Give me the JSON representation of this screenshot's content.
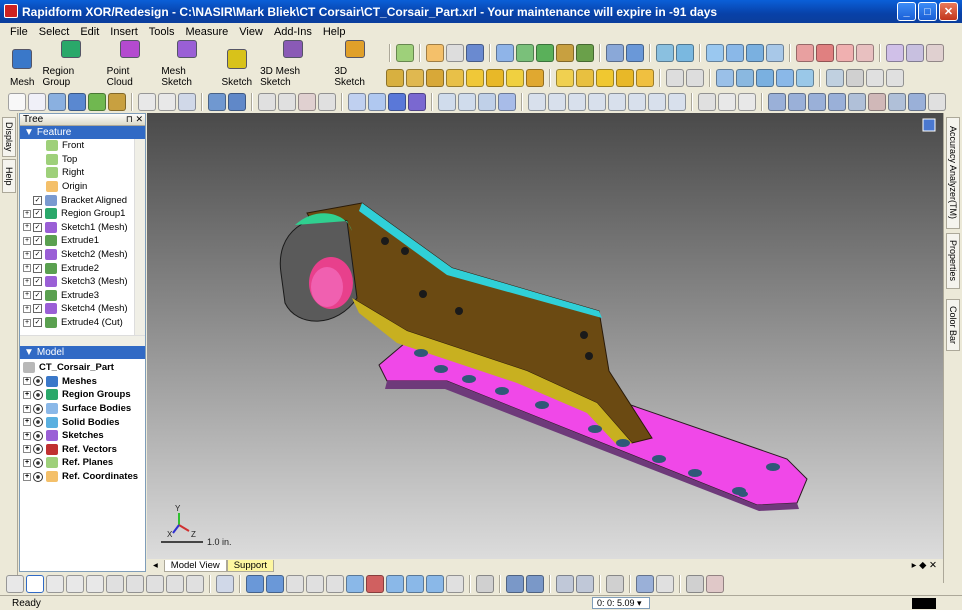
{
  "window": {
    "title": "Rapidform XOR/Redesign - C:\\NASIR\\Mark Bliek\\CT Corsair\\CT_Corsair_Part.xrl - Your maintenance will expire in -91 days",
    "minimize": "_",
    "maximize": "□",
    "close": "✕"
  },
  "menu": [
    "File",
    "Select",
    "Edit",
    "Insert",
    "Tools",
    "Measure",
    "View",
    "Add-Ins",
    "Help"
  ],
  "big_toolbar": [
    {
      "label": "Mesh",
      "color": "#3a78c9"
    },
    {
      "label": "Region Group",
      "color": "#2aa86a"
    },
    {
      "label": "Point Cloud",
      "color": "#b44ad0"
    },
    {
      "label": "Mesh Sketch",
      "color": "#9a5fd6"
    },
    {
      "label": "Sketch",
      "color": "#d8c21a"
    },
    {
      "label": "3D Mesh Sketch",
      "color": "#8a5ab6"
    },
    {
      "label": "3D Sketch",
      "color": "#e0a02a"
    }
  ],
  "left_strip_tabs": [
    "Display",
    "Help"
  ],
  "right_strip_tabs": [
    "Accuracy Analyzer(TM)",
    "Properties",
    "Color Bar"
  ],
  "tree_panel": {
    "title": "Tree",
    "feature_section": "Feature",
    "features": [
      {
        "label": "Front",
        "icon": "plane-icon",
        "expand": false,
        "check": false
      },
      {
        "label": "Top",
        "icon": "plane-icon",
        "expand": false,
        "check": false
      },
      {
        "label": "Right",
        "icon": "plane-icon",
        "expand": false,
        "check": false
      },
      {
        "label": "Origin",
        "icon": "origin-icon",
        "expand": false,
        "check": false
      },
      {
        "label": "Bracket Aligned",
        "icon": "align-icon",
        "expand": false,
        "check": true
      },
      {
        "label": "Region Group1",
        "icon": "region-group-icon",
        "expand": true,
        "check": true
      },
      {
        "label": "Sketch1 (Mesh)",
        "icon": "mesh-sketch-icon",
        "expand": true,
        "check": true
      },
      {
        "label": "Extrude1",
        "icon": "extrude-icon",
        "expand": true,
        "check": true
      },
      {
        "label": "Sketch2 (Mesh)",
        "icon": "mesh-sketch-icon",
        "expand": true,
        "check": true
      },
      {
        "label": "Extrude2",
        "icon": "extrude-icon",
        "expand": true,
        "check": true
      },
      {
        "label": "Sketch3 (Mesh)",
        "icon": "mesh-sketch-icon",
        "expand": true,
        "check": true
      },
      {
        "label": "Extrude3",
        "icon": "extrude-icon",
        "expand": true,
        "check": true
      },
      {
        "label": "Sketch4 (Mesh)",
        "icon": "mesh-sketch-icon",
        "expand": true,
        "check": true
      },
      {
        "label": "Extrude4 (Cut)",
        "icon": "extrude-icon",
        "expand": true,
        "check": true
      }
    ],
    "model_section": "Model",
    "model_root": "CT_Corsair_Part",
    "model_items": [
      "Meshes",
      "Region Groups",
      "Surface Bodies",
      "Solid Bodies",
      "Sketches",
      "Ref. Vectors",
      "Ref. Planes",
      "Ref. Coordinates"
    ]
  },
  "viewport": {
    "scale_label": "1.0 in.",
    "axis_labels": {
      "y": "Y",
      "x": "X",
      "z": "Z"
    }
  },
  "bottom_tabs": [
    "Model View",
    "Support"
  ],
  "status": {
    "text": "Ready",
    "coord": "0: 0: 5.09"
  },
  "colors": {
    "titlebar": "#0a5fd8",
    "selection": "#316ac5",
    "part_bronze": "#6b4a12",
    "part_magenta": "#f048e8",
    "part_cyan": "#30d0d8"
  }
}
